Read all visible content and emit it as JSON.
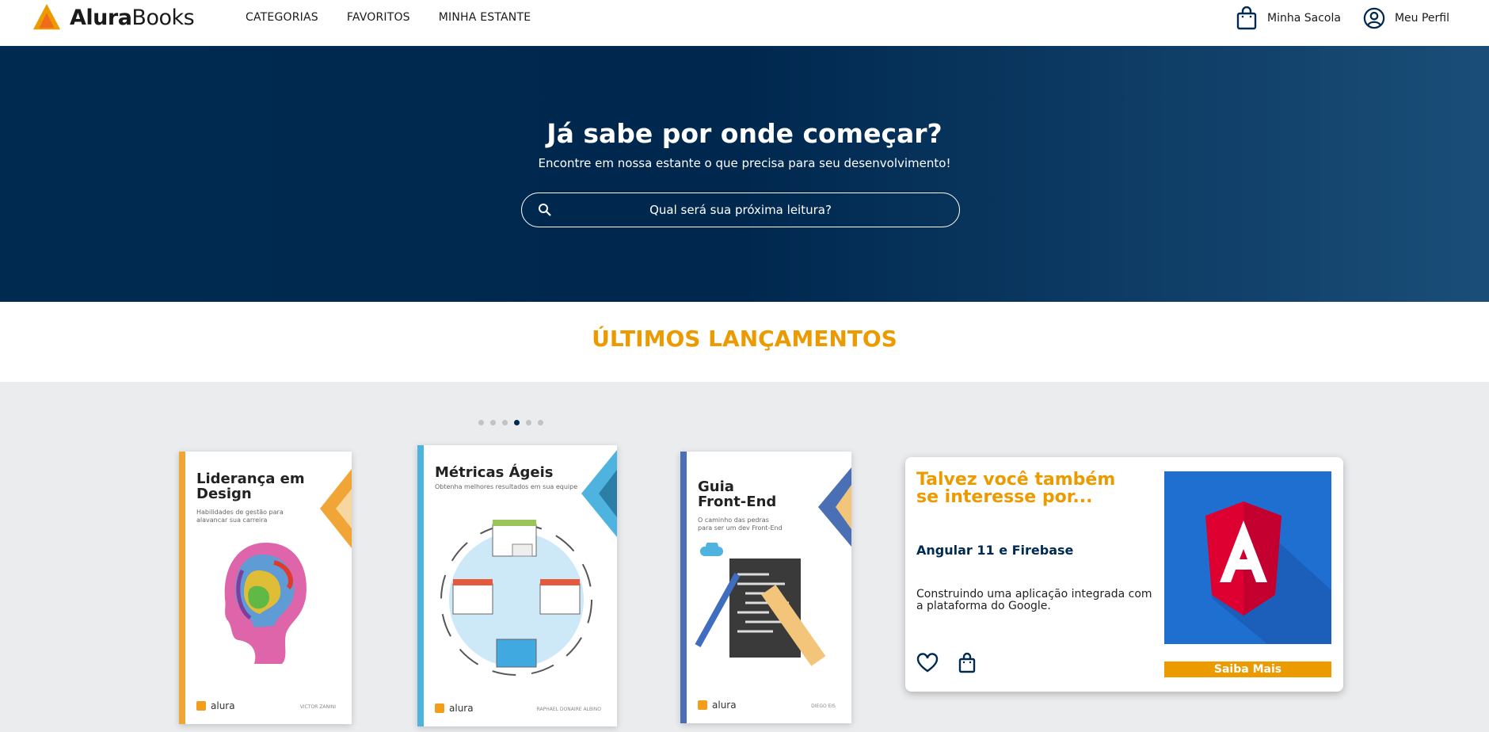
{
  "header": {
    "logo_primary": "Alura",
    "logo_secondary": "Books",
    "nav": [
      "CATEGORIAS",
      "FAVORITOS",
      "MINHA ESTANTE"
    ],
    "bag_label": "Minha Sacola",
    "profile_label": "Meu Perfil"
  },
  "hero": {
    "title": "Já sabe por onde começar?",
    "subtitle": "Encontre em nossa estante o que precisa para seu desenvolvimento!",
    "search_placeholder": "Qual será sua próxima leitura?"
  },
  "releases": {
    "title": "ÚLTIMOS LANÇAMENTOS",
    "dots_count": 6,
    "active_dot": 4
  },
  "books": [
    {
      "title": "Liderança em Design",
      "subtitle": "Habilidades de gestão para alavancar sua carreira",
      "brand": "alura",
      "author": "VICTOR ZANINI",
      "accent": "#f0a536"
    },
    {
      "title": "Métricas Ágeis",
      "subtitle": "Obtenha melhores resultados em sua equipe",
      "brand": "alura",
      "author": "RAPHAEL DONAIRE ALBINO",
      "accent": "#4fb3df"
    },
    {
      "title": "Guia Front-End",
      "subtitle": "O caminho das pedras para ser um dev Front-End",
      "brand": "alura",
      "author": "DIEGO EIS",
      "accent": "#4a6fb5"
    }
  ],
  "recommendation": {
    "heading": "Talvez você também se interesse por...",
    "book_title": "Angular 11 e Firebase",
    "description": "Construindo uma aplicação integrada com a plataforma do Google.",
    "button": "Saiba Mais",
    "image_letter": "A"
  },
  "colors": {
    "brand_orange": "#eb9b00",
    "navy": "#002a50"
  }
}
